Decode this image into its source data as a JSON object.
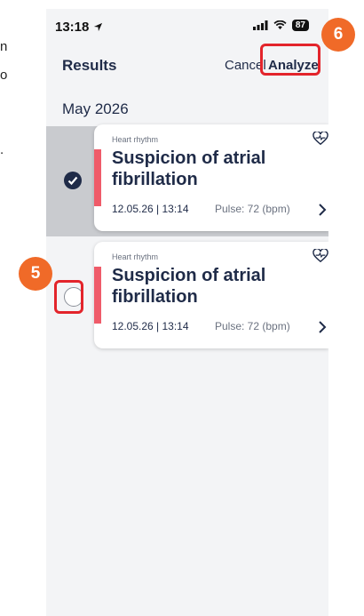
{
  "left_text_fragments": [
    "n",
    "o",
    "."
  ],
  "status_bar": {
    "time": "13:18",
    "battery": "87"
  },
  "nav": {
    "title": "Results",
    "cancel_label": "Cancel",
    "analyze_label": "Analyze"
  },
  "section_header": "May 2026",
  "cards": [
    {
      "category": "Heart rhythm",
      "title": "Suspicion of atrial fibrillation",
      "date": "12.05.26 | 13:14",
      "pulse": "Pulse: 72 (bpm)",
      "selected": true
    },
    {
      "category": "Heart rhythm",
      "title": "Suspicion of atrial fibrillation",
      "date": "12.05.26 | 13:14",
      "pulse": "Pulse: 72 (bpm)",
      "selected": false
    }
  ],
  "annotations": {
    "step_5": "5",
    "step_6": "6"
  },
  "colors": {
    "accent": "#ef5b69",
    "navy": "#1f2b48",
    "highlight": "#e3242b",
    "badge": "#f06a28"
  }
}
